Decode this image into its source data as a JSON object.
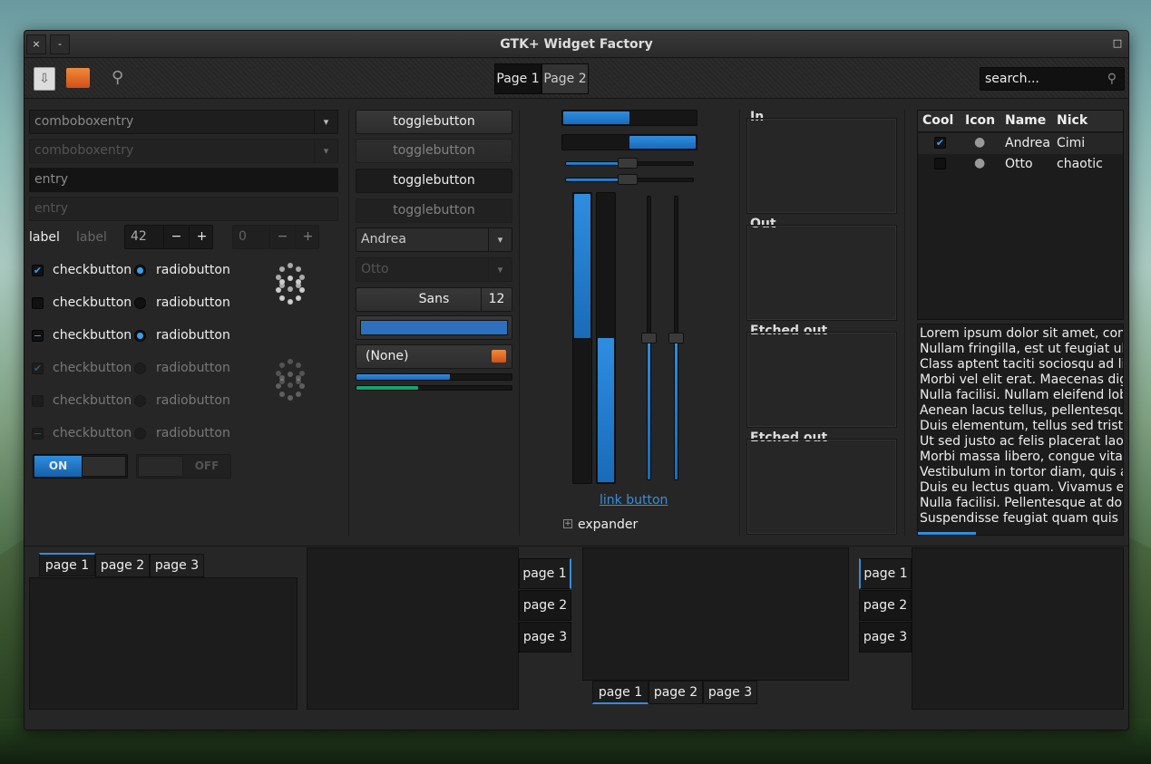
{
  "window": {
    "title": "GTK+ Widget Factory",
    "close": "×",
    "minimize": "-",
    "maximize": "□"
  },
  "toolbar": {
    "pages": [
      "Page 1",
      "Page 2"
    ],
    "search_placeholder": "search..."
  },
  "col1": {
    "combo1": "comboboxentry",
    "combo2": "comboboxentry",
    "entry1": "entry",
    "entry2": "entry",
    "label1": "label",
    "label2": "label",
    "spin1": "42",
    "spin2": "0",
    "minus": "−",
    "plus": "+",
    "checks": [
      {
        "c": "checkbutton",
        "r": "radiobutton"
      },
      {
        "c": "checkbutton",
        "r": "radiobutton"
      },
      {
        "c": "checkbutton",
        "r": "radiobutton"
      },
      {
        "c": "checkbutton",
        "r": "radiobutton"
      },
      {
        "c": "checkbutton",
        "r": "radiobutton"
      },
      {
        "c": "checkbutton",
        "r": "radiobutton"
      }
    ],
    "switch_on": "ON",
    "switch_off": "OFF"
  },
  "col2": {
    "toggles": [
      "togglebutton",
      "togglebutton",
      "togglebutton",
      "togglebutton"
    ],
    "combo_a": "Andrea",
    "combo_b": "Otto",
    "font": "Sans",
    "font_size": "12",
    "file": "(None)",
    "progress1": 0.6,
    "progress2": 0.4
  },
  "col3": {
    "hprog1": 0.5,
    "hprog2": 0.5,
    "hscale1": 0.45,
    "hscale2": 0.45,
    "vprog1": 0.5,
    "vprog2": 0.5,
    "vscale1": 0.5,
    "vscale2": 0.5,
    "link": "link button",
    "expander": "expander"
  },
  "frames": [
    "In",
    "Out",
    "Etched out",
    "Etched out"
  ],
  "tree": {
    "headers": [
      "Cool",
      "Icon",
      "Name",
      "Nick"
    ],
    "rows": [
      {
        "name": "Andrea",
        "nick": "Cimi"
      },
      {
        "name": "Otto",
        "nick": "chaotic"
      }
    ]
  },
  "text": [
    "Lorem ipsum dolor sit amet, conse",
    "Nullam fringilla, est ut feugiat ultr",
    "Class aptent taciti sociosqu ad lito",
    "Morbi vel elit erat. Maecenas digni",
    "Nulla facilisi. Nullam eleifend lobo",
    "Aenean lacus tellus, pellentesque c",
    "Duis elementum, tellus sed tristiqu",
    "Ut sed justo ac felis placerat laore",
    "Morbi massa libero, congue vitae s",
    "Vestibulum in tortor diam, quis ali",
    "Duis eu lectus quam. Vivamus eget",
    "Nulla facilisi. Pellentesque at dolo",
    "Suspendisse feugiat quam quis do"
  ],
  "notebooks": {
    "tabs": [
      "page 1",
      "page 2",
      "page 3"
    ]
  },
  "colors": {
    "accent": "#2f8de0",
    "bg": "#262626"
  }
}
